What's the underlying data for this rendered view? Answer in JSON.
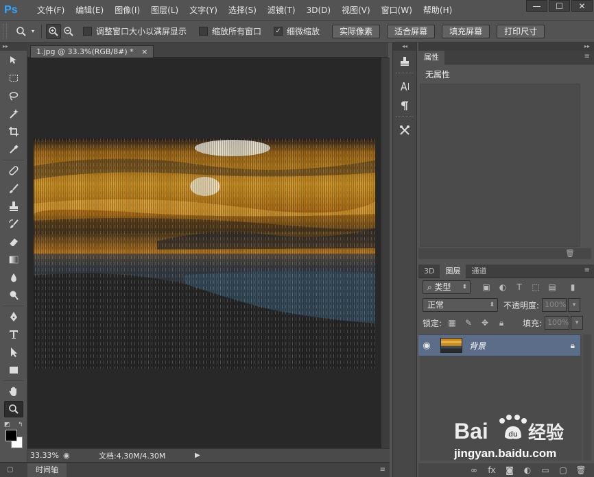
{
  "app": {
    "logo": "Ps"
  },
  "menu": [
    "文件(F)",
    "编辑(E)",
    "图像(I)",
    "图层(L)",
    "文字(Y)",
    "选择(S)",
    "滤镜(T)",
    "3D(D)",
    "视图(V)",
    "窗口(W)",
    "帮助(H)"
  ],
  "window_controls": {
    "minimize": "—",
    "maximize": "☐",
    "close": "✕"
  },
  "options": {
    "resize_windows": {
      "label": "调整窗口大小以满屏显示",
      "checked": false
    },
    "zoom_all": {
      "label": "缩放所有窗口",
      "checked": false
    },
    "scrubby_zoom": {
      "label": "细微缩放",
      "checked": true
    },
    "buttons": [
      "实际像素",
      "适合屏幕",
      "填充屏幕",
      "打印尺寸"
    ]
  },
  "document": {
    "tab_title": "1.jpg @ 33.3%(RGB/8#) *",
    "zoom": "33.33%",
    "doc_size": "文档:4.30M/4.30M"
  },
  "timeline": {
    "label": "时间轴"
  },
  "properties": {
    "tab": "属性",
    "empty_text": "无属性"
  },
  "layers": {
    "tabs": [
      "3D",
      "图层",
      "通道"
    ],
    "active_tab": "图层",
    "filter_kind": "类型",
    "blend_mode": "正常",
    "opacity_label": "不透明度:",
    "opacity_value": "100%",
    "lock_label": "锁定:",
    "fill_label": "填充:",
    "fill_value": "100%",
    "items": [
      {
        "name": "背景",
        "visible": true,
        "locked": true
      }
    ]
  },
  "watermark": {
    "brand": "Bai百度经验",
    "url": "jingyan.baidu.com"
  }
}
